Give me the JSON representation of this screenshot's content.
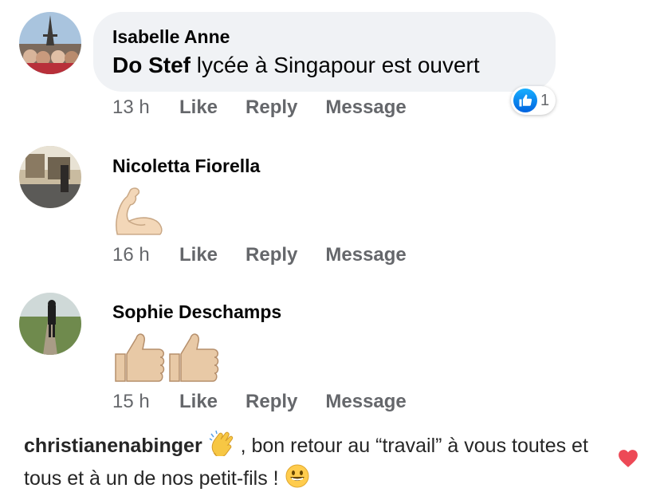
{
  "comments": [
    {
      "name": "Isabelle Anne",
      "tag": "Do Stef",
      "text": " lycée à Singapour est ouvert",
      "time": "13 h",
      "like": "Like",
      "reply": "Reply",
      "message": "Message",
      "reaction_count": "1",
      "reaction_icon": "thumbs-up-icon"
    },
    {
      "name": "Nicoletta Fiorella",
      "emoji": "flexed-biceps-icon",
      "time": "16 h",
      "like": "Like",
      "reply": "Reply",
      "message": "Message"
    },
    {
      "name": "Sophie Deschamps",
      "emoji": "thumbs-up-emoji-icon",
      "time": "15 h",
      "like": "Like",
      "reply": "Reply",
      "message": "Message"
    }
  ],
  "instagram_comment": {
    "username": "christianenabinger",
    "text_part1": " , bon retour au “travail” à vous toutes et tous et à un de nos petit-fils ! ",
    "emoji_1": "clapping-hands-icon",
    "emoji_2": "grinning-face-icon",
    "heart_icon": "heart-icon",
    "heart_color": "#ed4956"
  },
  "colors": {
    "bubble": "#f0f2f5",
    "meta_text": "#65676b",
    "like_blue": "#1877f2"
  }
}
